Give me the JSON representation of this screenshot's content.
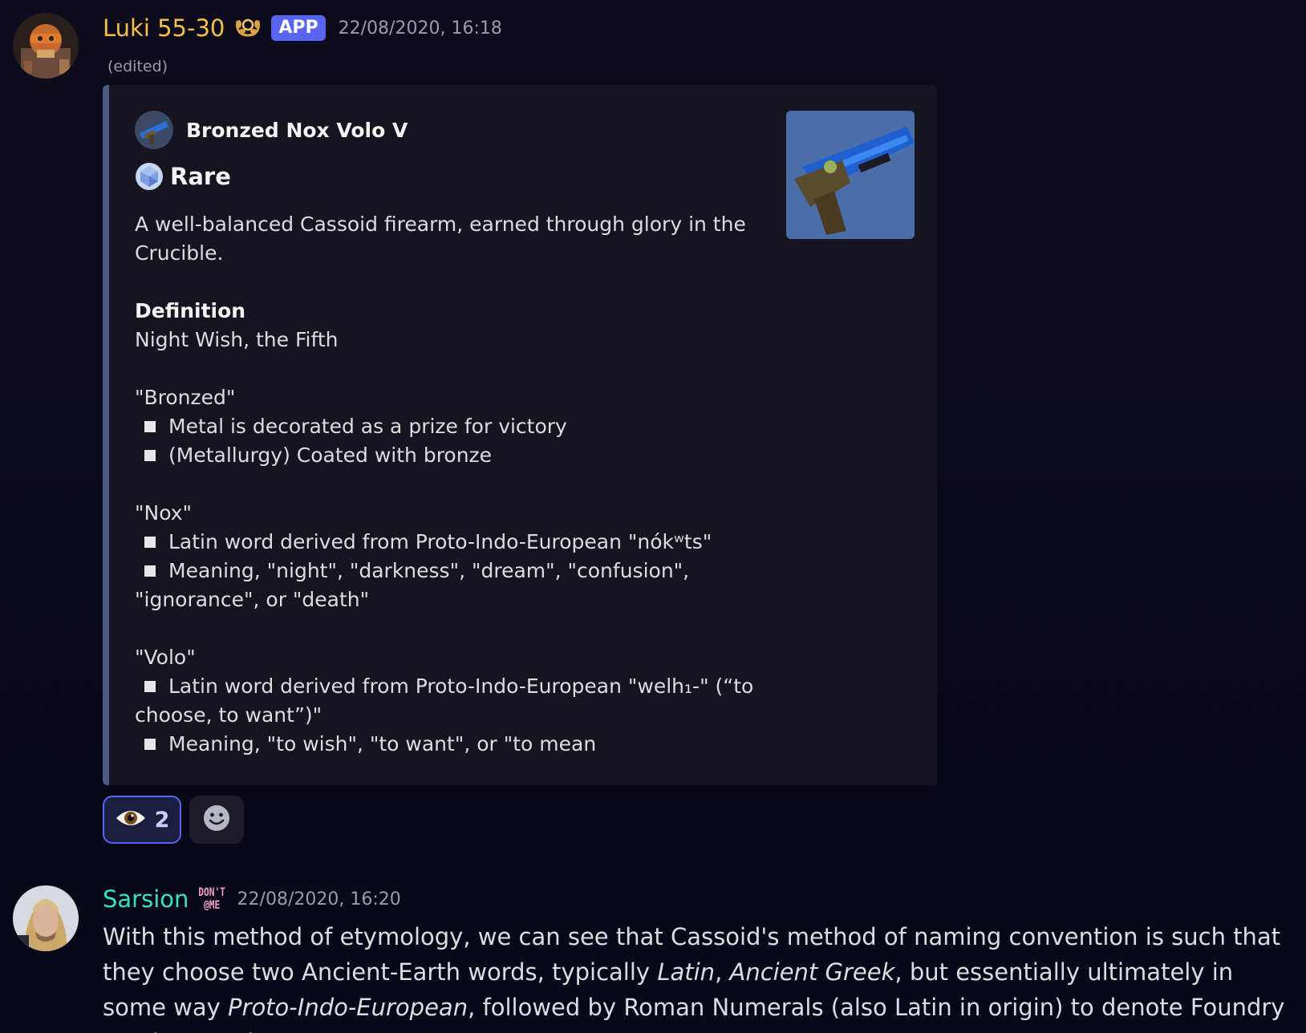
{
  "message1": {
    "username": "Luki 55-30",
    "username_color": "#f3c14a",
    "role_icon": "laurel-icon",
    "badge": "APP",
    "timestamp": "22/08/2020, 16:18",
    "edited": "(edited)",
    "embed": {
      "accent_color": "#4b5a85",
      "author": "Bronzed Nox Volo V",
      "title_icon": "rare-engram-icon",
      "title": "Rare",
      "description": "A well-balanced Cassoid firearm, earned through glory in the Crucible.",
      "definition_heading": "Definition",
      "definition_text": "Night Wish, the Fifth",
      "sections": [
        {
          "term": "\"Bronzed\"",
          "bullets": [
            "Metal is decorated as a prize for victory",
            "(Metallurgy) Coated with bronze"
          ]
        },
        {
          "term": "\"Nox\"",
          "bullets": [
            "Latin word derived from Proto-Indo-European \"nókʷts\"",
            "Meaning, \"night\", \"darkness\", \"dream\", \"confusion\", \"ignorance\", or \"death\""
          ]
        },
        {
          "term": "\"Volo\"",
          "bullets": [
            "Latin word derived from Proto-Indo-European \"welh₁-\" (“to choose, to want”)\"",
            "Meaning, \"to wish\", \"to want\", or \"to mean"
          ]
        }
      ]
    },
    "reactions": [
      {
        "icon": "eye-icon",
        "count": "2"
      }
    ],
    "add_reaction_icon": "smiley-icon"
  },
  "message2": {
    "username": "Sarsion",
    "username_color": "#35e3c4",
    "role_badge": [
      "DON'T",
      "@ME"
    ],
    "timestamp": "22/08/2020, 16:20",
    "text_parts": [
      "With this method of etymology, we can see that Cassoid's method of naming convention is such that they choose two Ancient-Earth words, typically ",
      "Latin",
      ", ",
      "Ancient Greek",
      ", but essentially ultimately in some way ",
      "Proto-Indo-European",
      ", followed by Roman Numerals (also Latin in origin) to denote Foundry version number."
    ]
  }
}
